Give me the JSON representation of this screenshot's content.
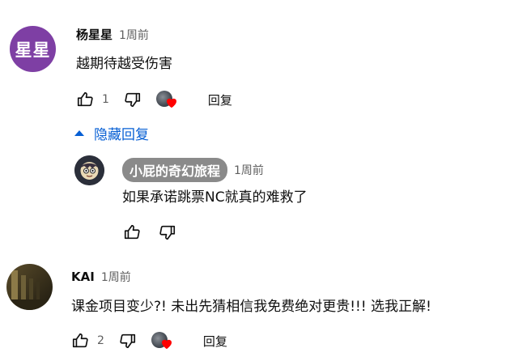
{
  "comments": [
    {
      "avatar_text": "星星",
      "author": "杨星星",
      "time": "1周前",
      "text": "越期待越受伤害",
      "likes": "1",
      "reply_label": "回复"
    },
    {
      "author": "KAI",
      "time": "1周前",
      "text": "课金项目变少?! 未出先猜相信我免费绝对更贵!!! 选我正解!",
      "likes": "2",
      "reply_label": "回复"
    }
  ],
  "hide_replies_label": "隐藏回复",
  "reply": {
    "author": "小屁的奇幻旅程",
    "time": "1周前",
    "text": "如果承诺跳票NC就真的难救了"
  },
  "colors": {
    "link_blue": "#065fd4",
    "heart_red": "#ff0000",
    "avatar_purple": "#7e3fa4",
    "chip_gray": "#8a8a8a"
  },
  "icons": [
    "thumb-up-icon",
    "thumb-down-icon",
    "heart-icon",
    "caret-up-icon"
  ]
}
